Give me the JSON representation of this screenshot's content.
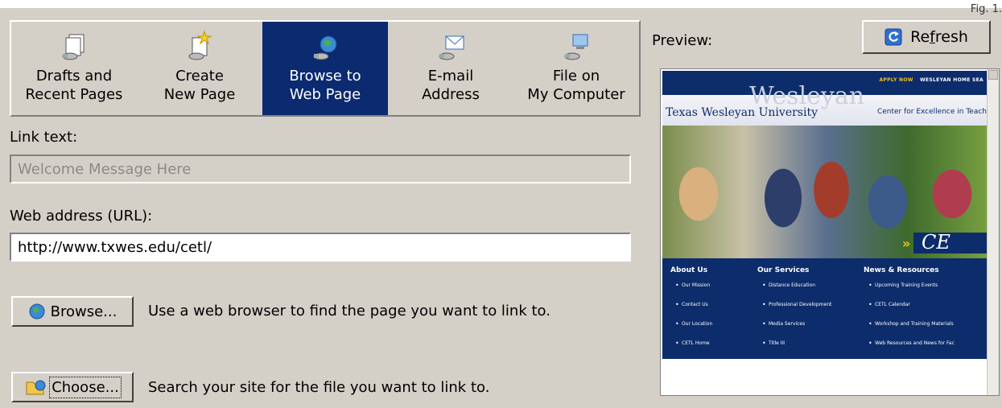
{
  "figure_label": "Fig. 1.",
  "tabs": [
    {
      "label": "Drafts and\nRecent Pages",
      "icon": "drafts-icon",
      "active": false
    },
    {
      "label": "Create\nNew Page",
      "icon": "new-page-icon",
      "active": false
    },
    {
      "label": "Browse to\nWeb Page",
      "icon": "browse-web-icon",
      "active": true
    },
    {
      "label": "E-mail\nAddress",
      "icon": "email-icon",
      "active": false
    },
    {
      "label": "File on\nMy Computer",
      "icon": "computer-file-icon",
      "active": false
    }
  ],
  "link_text": {
    "label": "Link text:",
    "value": "Welcome Message Here"
  },
  "url": {
    "label": "Web address (URL):",
    "value": "http://www.txwes.edu/cetl/"
  },
  "browse": {
    "button": "Browse...",
    "description": "Use a web browser to find the page you want to link to."
  },
  "choose": {
    "button": "Choose...",
    "description": "Search your site for the file you want to link to."
  },
  "preview": {
    "label": "Preview:",
    "refresh": "Refresh",
    "site": {
      "top_links": [
        "APPLY NOW",
        "WESLEYAN HOME",
        "SEA"
      ],
      "watermark": "Wesleyan",
      "university": "Texas Wesleyan University",
      "center": "Center for Excellence in Teach",
      "banner_text": "CE",
      "columns": [
        {
          "heading": "About Us",
          "items": [
            "Our Mission",
            "Contact Us",
            "Our Location",
            "CETL Home"
          ]
        },
        {
          "heading": "Our Services",
          "items": [
            "Distance Education",
            "Professional Development",
            "Media Services",
            "Title III"
          ]
        },
        {
          "heading": "News & Resources",
          "items": [
            "Upcoming Training Events",
            "CETL Calendar",
            "Workshop and Training Materials",
            "Web Resources and News for Fac"
          ]
        }
      ]
    }
  },
  "colors": {
    "active_tab": "#0b2a6f",
    "dialog_bg": "#d4d0c8",
    "site_blue": "#0c2c6b"
  }
}
